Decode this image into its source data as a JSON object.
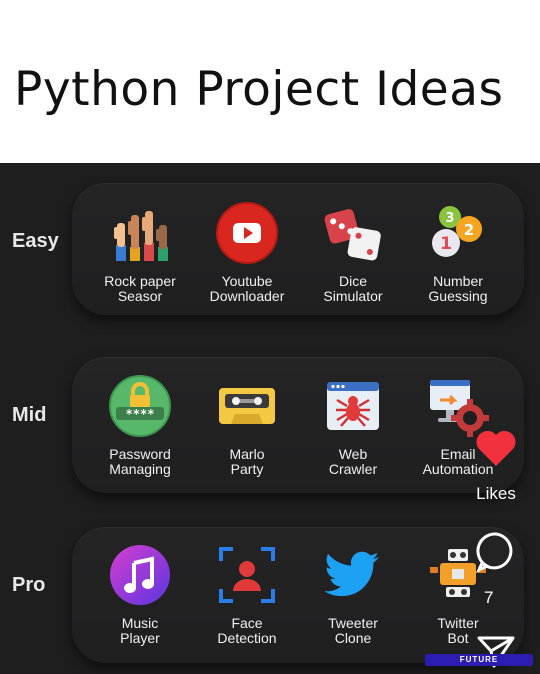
{
  "title": "Python Project Ideas",
  "rows": [
    {
      "label": "Easy",
      "items": [
        {
          "caption": "Rock paper\nSeasor",
          "icon": "raised-hands-icon"
        },
        {
          "caption": "Youtube\nDownloader",
          "icon": "youtube-play-icon"
        },
        {
          "caption": "Dice\nSimulator",
          "icon": "dice-icon"
        },
        {
          "caption": "Number\nGuessing",
          "icon": "number-balls-icon"
        }
      ]
    },
    {
      "label": "Mid",
      "items": [
        {
          "caption": "Password\nManaging",
          "icon": "password-lock-icon"
        },
        {
          "caption": "Marlo\nParty",
          "icon": "cassette-icon"
        },
        {
          "caption": "Web\nCrawler",
          "icon": "web-spider-icon"
        },
        {
          "caption": "Email\nAutomation",
          "icon": "email-automation-icon"
        }
      ]
    },
    {
      "label": "Pro",
      "items": [
        {
          "caption": "Music\nPlayer",
          "icon": "music-note-icon"
        },
        {
          "caption": "Face\nDetection",
          "icon": "face-detection-icon"
        },
        {
          "caption": "Tweeter\nClone",
          "icon": "twitter-bird-icon"
        },
        {
          "caption": "Twitter\nBot",
          "icon": "robot-icon"
        }
      ]
    }
  ],
  "overlay": {
    "likes_label": "Likes",
    "comment_count": "7",
    "watermark": "FUTURE"
  },
  "colors": {
    "heart": "#f2313f",
    "youtube": "#d9261f",
    "twitter": "#1da1f2",
    "background": "#1e1e1f"
  }
}
